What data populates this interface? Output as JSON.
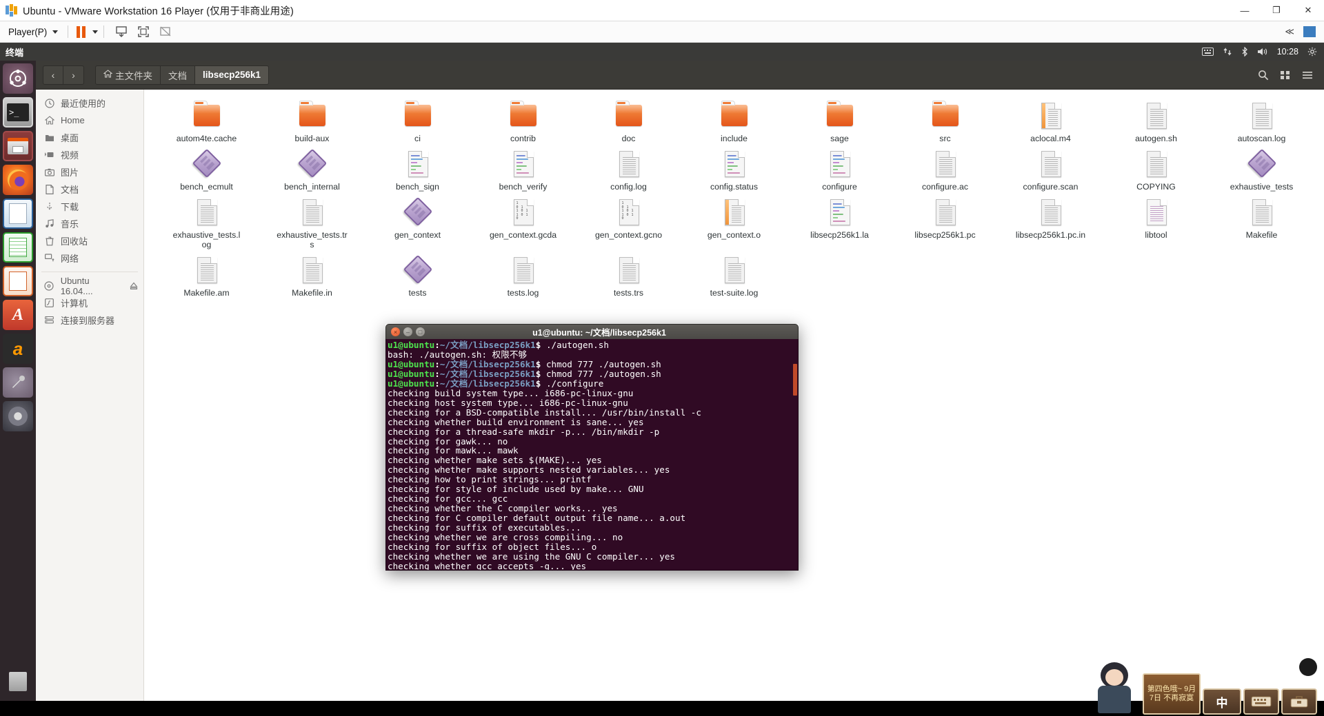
{
  "vmware": {
    "title": "Ubuntu - VMware Workstation 16 Player (仅用于非商业用途)",
    "logo_icon": "vmware-logo-icon",
    "window_buttons": [
      {
        "name": "minimize",
        "glyph": "—"
      },
      {
        "name": "maximize",
        "glyph": "❐"
      },
      {
        "name": "close",
        "glyph": "✕"
      }
    ],
    "toolbar": {
      "player_menu": "Player(P)",
      "pause_label": "pause-button",
      "icons": [
        "send-ctrl-alt-del-icon",
        "fullscreen-icon",
        "unity-mode-icon"
      ],
      "collapse_label": "≪",
      "sidebar_toggle": "sidebar-toggle-icon"
    }
  },
  "ubuntu": {
    "topbar": {
      "app_name": "终端",
      "indicators": [
        "keyboard-icon",
        "network-icon",
        "bluetooth-icon",
        "volume-icon",
        "gear-icon"
      ],
      "clock": "10:28"
    },
    "launcher": [
      {
        "name": "dash-home",
        "label": "Ubuntu Dash"
      },
      {
        "name": "terminal",
        "label": "终端"
      },
      {
        "name": "files",
        "label": "文件"
      },
      {
        "name": "firefox",
        "label": "Firefox"
      },
      {
        "name": "libreoffice-writer",
        "label": "LibreOffice Writer"
      },
      {
        "name": "libreoffice-calc",
        "label": "LibreOffice Calc"
      },
      {
        "name": "libreoffice-impress",
        "label": "LibreOffice Impress"
      },
      {
        "name": "ubuntu-software",
        "label": "Ubuntu 软件中心"
      },
      {
        "name": "amazon",
        "label": "Amazon"
      },
      {
        "name": "system-settings",
        "label": "系统设置"
      },
      {
        "name": "dvd-player",
        "label": "DVD"
      },
      {
        "name": "trash",
        "label": "回收站"
      }
    ]
  },
  "nautilus": {
    "nav": {
      "back": "‹",
      "forward": "›"
    },
    "breadcrumb": [
      {
        "label": "主文件夹",
        "icon": "home-icon",
        "active": false
      },
      {
        "label": "文档",
        "icon": "",
        "active": false
      },
      {
        "label": "libsecp256k1",
        "icon": "",
        "active": true
      }
    ],
    "header_icons": [
      "search-icon",
      "view-list-icon",
      "menu-icon"
    ],
    "places": [
      {
        "label": "最近使用的",
        "icon": "clock-icon"
      },
      {
        "label": "Home",
        "icon": "home-icon"
      },
      {
        "label": "桌面",
        "icon": "folder-icon"
      },
      {
        "label": "视频",
        "icon": "video-icon"
      },
      {
        "label": "图片",
        "icon": "camera-icon"
      },
      {
        "label": "文档",
        "icon": "document-icon"
      },
      {
        "label": "下载",
        "icon": "download-icon"
      },
      {
        "label": "音乐",
        "icon": "music-icon"
      },
      {
        "label": "回收站",
        "icon": "trash-icon"
      },
      {
        "label": "网络",
        "icon": "network-icon"
      }
    ],
    "devices": [
      {
        "label": "Ubuntu 16.04....",
        "icon": "disc-icon",
        "eject": true
      },
      {
        "label": "计算机",
        "icon": "computer-icon",
        "eject": false
      },
      {
        "label": "连接到服务器",
        "icon": "server-icon",
        "eject": false
      }
    ],
    "files": [
      {
        "name": "autom4te.cache",
        "type": "folder"
      },
      {
        "name": "build-aux",
        "type": "folder"
      },
      {
        "name": "ci",
        "type": "folder"
      },
      {
        "name": "contrib",
        "type": "folder"
      },
      {
        "name": "doc",
        "type": "folder"
      },
      {
        "name": "include",
        "type": "folder"
      },
      {
        "name": "sage",
        "type": "folder"
      },
      {
        "name": "src",
        "type": "folder"
      },
      {
        "name": "aclocal.m4",
        "type": "object"
      },
      {
        "name": "autogen.sh",
        "type": "doc"
      },
      {
        "name": "autoscan.log",
        "type": "doc"
      },
      {
        "name": "bench_ecmult",
        "type": "exec"
      },
      {
        "name": "bench_internal",
        "type": "exec"
      },
      {
        "name": "bench_sign",
        "type": "src"
      },
      {
        "name": "bench_verify",
        "type": "src"
      },
      {
        "name": "config.log",
        "type": "doc"
      },
      {
        "name": "config.status",
        "type": "src"
      },
      {
        "name": "configure",
        "type": "src"
      },
      {
        "name": "configure.ac",
        "type": "doc"
      },
      {
        "name": "configure.scan",
        "type": "doc"
      },
      {
        "name": "COPYING",
        "type": "doc"
      },
      {
        "name": "exhaustive_tests",
        "type": "exec"
      },
      {
        "name": "exhaustive_tests.log",
        "type": "doc"
      },
      {
        "name": "exhaustive_tests.trs",
        "type": "doc"
      },
      {
        "name": "gen_context",
        "type": "exec"
      },
      {
        "name": "gen_context.gcda",
        "type": "bin"
      },
      {
        "name": "gen_context.gcno",
        "type": "bin"
      },
      {
        "name": "gen_context.o",
        "type": "object"
      },
      {
        "name": "libsecp256k1.la",
        "type": "src"
      },
      {
        "name": "libsecp256k1.pc",
        "type": "doc"
      },
      {
        "name": "libsecp256k1.pc.in",
        "type": "doc"
      },
      {
        "name": "libtool",
        "type": "pc"
      },
      {
        "name": "Makefile",
        "type": "doc"
      },
      {
        "name": "Makefile.am",
        "type": "doc"
      },
      {
        "name": "Makefile.in",
        "type": "doc"
      },
      {
        "name": "tests",
        "type": "exec"
      },
      {
        "name": "tests.log",
        "type": "doc"
      },
      {
        "name": "tests.trs",
        "type": "doc"
      },
      {
        "name": "test-suite.log",
        "type": "doc"
      }
    ],
    "binary_glyph": "1\n0 1\n1 0 1\n1 0 1 0"
  },
  "terminal": {
    "title": "u1@ubuntu: ~/文档/libsecp256k1",
    "window_buttons": [
      "close",
      "minimize",
      "maximize"
    ],
    "prompt_user": "u1@ubuntu",
    "prompt_path": "~/文档/libsecp256k1",
    "prompt_sym": "$",
    "lines": [
      {
        "type": "prompt",
        "cmd": " ./autogen.sh"
      },
      {
        "type": "out",
        "text": "bash: ./autogen.sh: 权限不够"
      },
      {
        "type": "prompt",
        "cmd": " chmod 777 ./autogen.sh"
      },
      {
        "type": "prompt",
        "cmd": " chmod 777 ./autogen.sh"
      },
      {
        "type": "prompt",
        "cmd": " ./configure"
      },
      {
        "type": "out",
        "text": "checking build system type... i686-pc-linux-gnu"
      },
      {
        "type": "out",
        "text": "checking host system type... i686-pc-linux-gnu"
      },
      {
        "type": "out",
        "text": "checking for a BSD-compatible install... /usr/bin/install -c"
      },
      {
        "type": "out",
        "text": "checking whether build environment is sane... yes"
      },
      {
        "type": "out",
        "text": "checking for a thread-safe mkdir -p... /bin/mkdir -p"
      },
      {
        "type": "out",
        "text": "checking for gawk... no"
      },
      {
        "type": "out",
        "text": "checking for mawk... mawk"
      },
      {
        "type": "out",
        "text": "checking whether make sets $(MAKE)... yes"
      },
      {
        "type": "out",
        "text": "checking whether make supports nested variables... yes"
      },
      {
        "type": "out",
        "text": "checking how to print strings... printf"
      },
      {
        "type": "out",
        "text": "checking for style of include used by make... GNU"
      },
      {
        "type": "out",
        "text": "checking for gcc... gcc"
      },
      {
        "type": "out",
        "text": "checking whether the C compiler works... yes"
      },
      {
        "type": "out",
        "text": "checking for C compiler default output file name... a.out"
      },
      {
        "type": "out",
        "text": "checking for suffix of executables... "
      },
      {
        "type": "out",
        "text": "checking whether we are cross compiling... no"
      },
      {
        "type": "out",
        "text": "checking for suffix of object files... o"
      },
      {
        "type": "out",
        "text": "checking whether we are using the GNU C compiler... yes"
      },
      {
        "type": "out",
        "text": "checking whether gcc accepts -g... yes"
      }
    ]
  },
  "ime": {
    "mode_label": "中",
    "banner_text": "第四色哦~\n9月7日 不再寂寞",
    "keyboard_icon": "keyboard-icon",
    "toolbox_icon": "toolbox-icon"
  },
  "colors": {
    "terminal_bg": "#300a24",
    "prompt_green": "#4ee44e",
    "prompt_blue": "#7a9ec2",
    "ubuntu_orange": "#e8590c",
    "header_dark": "#3c3b37"
  }
}
